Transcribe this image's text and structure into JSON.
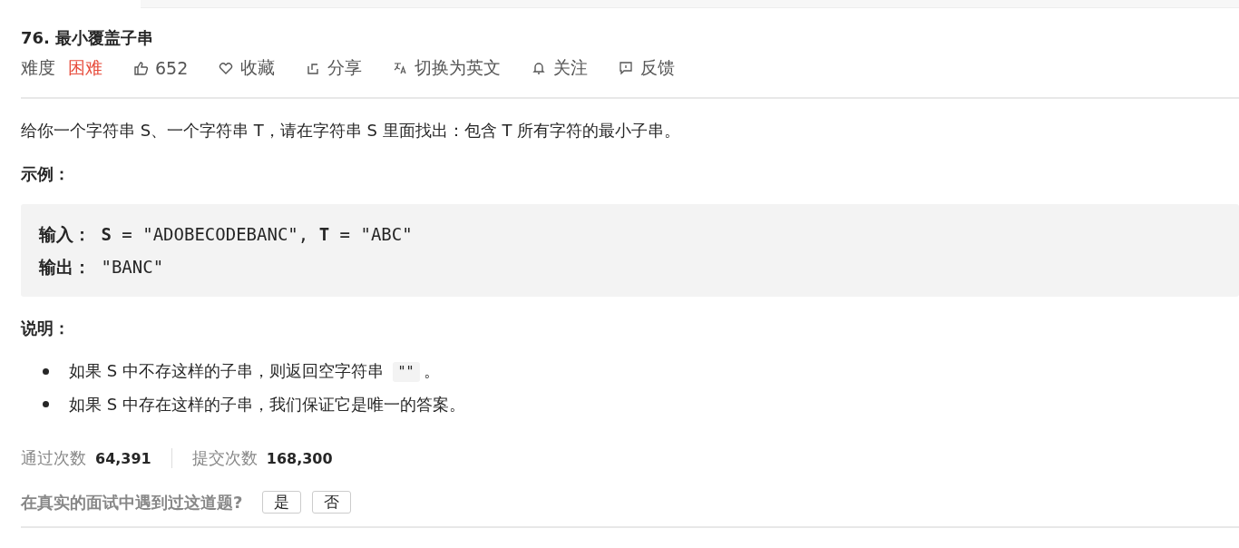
{
  "title": "76. 最小覆盖子串",
  "meta": {
    "difficulty_label": "难度",
    "difficulty": "困难"
  },
  "actions": [
    {
      "kind": "like",
      "label": "652"
    },
    {
      "kind": "favorite",
      "label": "收藏"
    },
    {
      "kind": "share",
      "label": "分享"
    },
    {
      "kind": "translate",
      "label": "切换为英文"
    },
    {
      "kind": "follow",
      "label": "关注"
    },
    {
      "kind": "feedback",
      "label": "反馈"
    }
  ],
  "description": "给你一个字符串 S、一个字符串 T，请在字符串 S 里面找出：包含 T 所有字符的最小子串。",
  "example_heading": "示例：",
  "example_lines": [
    "**输入：** **S** = \"ADOBECODEBANC\", **T** = \"ABC\"",
    "**输出：** \"BANC\""
  ],
  "notes_heading": "说明：",
  "notes": [
    [
      {
        "kind": "text",
        "text": "如果 S 中不存这样的子串，则返回空字符串 "
      },
      {
        "kind": "code",
        "text": "\"\""
      },
      {
        "kind": "text",
        "text": "。"
      }
    ],
    [
      {
        "kind": "text",
        "text": "如果 S 中存在这样的子串，我们保证它是唯一的答案。"
      }
    ]
  ],
  "stats": [
    {
      "label": "通过次数",
      "value": "64,391"
    },
    {
      "label": "提交次数",
      "value": "168,300"
    }
  ],
  "question": "在真实的面试中遇到过这道题?",
  "answers": [
    "是",
    "否"
  ]
}
